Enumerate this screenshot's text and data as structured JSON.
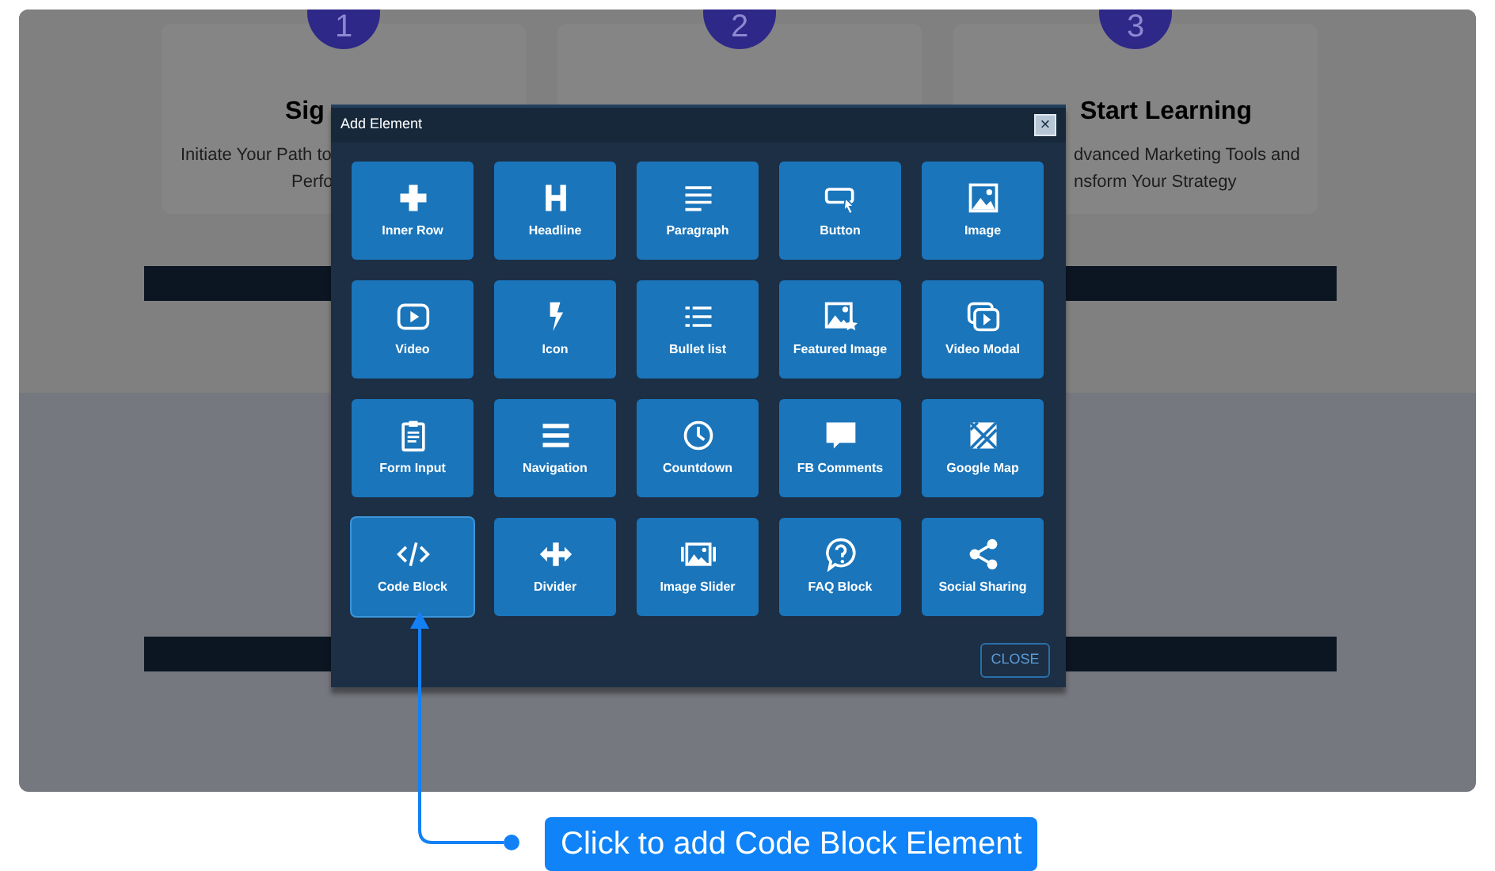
{
  "background_steps": [
    {
      "number": "1",
      "title": "Sig",
      "description": [
        "Initiate Your Path to",
        "Perfo"
      ]
    },
    {
      "number": "2"
    },
    {
      "number": "3",
      "title": "Start Learning",
      "description": [
        "dvanced Marketing Tools and",
        "nsform Your Strategy"
      ]
    }
  ],
  "dialog": {
    "title": "Add Element",
    "close_glyph": "×",
    "elements": [
      {
        "label": "Inner Row",
        "selected": false
      },
      {
        "label": "Headline",
        "selected": false
      },
      {
        "label": "Paragraph",
        "selected": false
      },
      {
        "label": "Button",
        "selected": false
      },
      {
        "label": "Image",
        "selected": false
      },
      {
        "label": "Video",
        "selected": false
      },
      {
        "label": "Icon",
        "selected": false
      },
      {
        "label": "Bullet list",
        "selected": false
      },
      {
        "label": "Featured Image",
        "selected": false
      },
      {
        "label": "Video Modal",
        "selected": false
      },
      {
        "label": "Form Input",
        "selected": false
      },
      {
        "label": "Navigation",
        "selected": false
      },
      {
        "label": "Countdown",
        "selected": false
      },
      {
        "label": "FB Comments",
        "selected": false
      },
      {
        "label": "Google Map",
        "selected": false
      },
      {
        "label": "Code Block",
        "selected": true
      },
      {
        "label": "Divider",
        "selected": false
      },
      {
        "label": "Image Slider",
        "selected": false
      },
      {
        "label": "FAQ Block",
        "selected": false
      },
      {
        "label": "Social Sharing",
        "selected": false
      }
    ],
    "close_button": "CLOSE"
  },
  "callout": {
    "text": "Click to add Code Block Element"
  }
}
